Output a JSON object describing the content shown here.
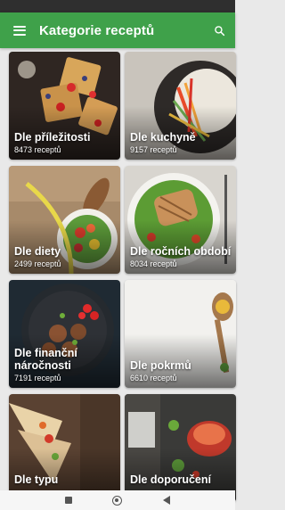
{
  "appbar": {
    "title": "Kategorie receptů",
    "menu_icon": "hamburger-menu-icon",
    "search_icon": "search-icon"
  },
  "categories": [
    {
      "label": "Dle příležitosti",
      "count": "8473 receptů"
    },
    {
      "label": "Dle kuchyně",
      "count": "9157 receptů"
    },
    {
      "label": "Dle diety",
      "count": "2499 receptů"
    },
    {
      "label": "Dle ročních období",
      "count": "8034 receptů"
    },
    {
      "label": "Dle finanční náročnosti",
      "count": "7191 receptů"
    },
    {
      "label": "Dle pokrmů",
      "count": "6610 receptů"
    },
    {
      "label": "Dle typu",
      "count": ""
    },
    {
      "label": "Dle doporučení",
      "count": ""
    }
  ],
  "colors": {
    "accent": "#3fa14a"
  }
}
